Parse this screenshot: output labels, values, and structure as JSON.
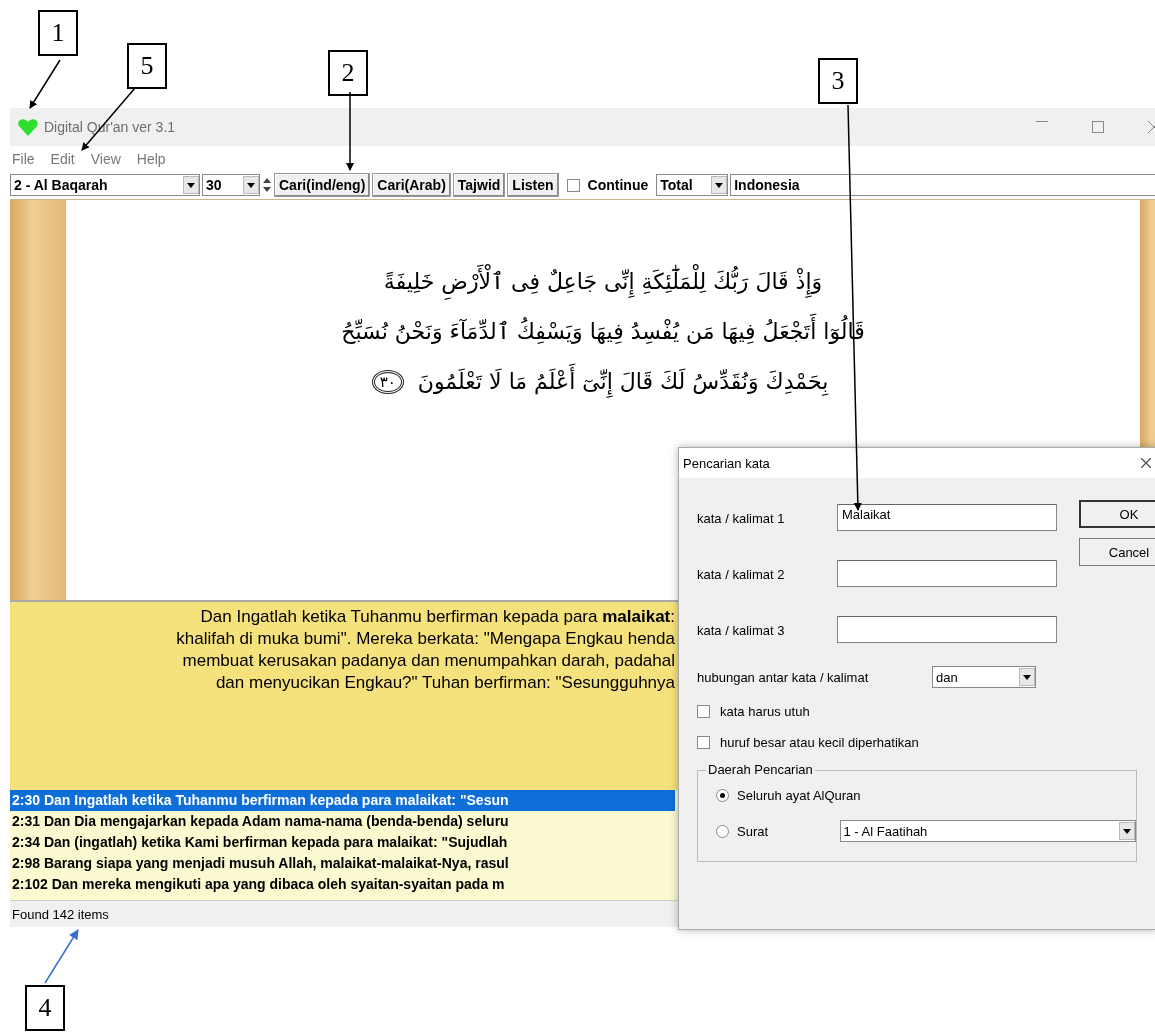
{
  "callouts": [
    {
      "label": "1"
    },
    {
      "label": "5"
    },
    {
      "label": "2"
    },
    {
      "label": "3"
    },
    {
      "label": "4"
    }
  ],
  "window": {
    "title": "Digital Qur'an ver 3.1"
  },
  "menu": [
    {
      "label": "File"
    },
    {
      "label": "Edit"
    },
    {
      "label": "View"
    },
    {
      "label": "Help"
    }
  ],
  "toolbar": {
    "surah": "2 - Al Baqarah",
    "ayah": "30",
    "buttons": [
      {
        "label": "Cari(ind/eng)"
      },
      {
        "label": "Cari(Arab)"
      },
      {
        "label": "Tajwid"
      },
      {
        "label": "Listen"
      }
    ],
    "continue": {
      "label": "Continue",
      "checked": false
    },
    "mode": "Total",
    "language": "Indonesia"
  },
  "verse": {
    "lines": [
      "وَإِذْ قَالَ رَبُّكَ لِلْمَلَٰٓئِكَةِ إِنِّى جَاعِلٌ فِى ٱلْأَرْضِ خَلِيفَةً",
      "قَالُوٓا أَتَجْعَلُ فِيهَا مَن يُفْسِدُ فِيهَا وَيَسْفِكُ ٱلدِّمَآءَ وَنَحْنُ نُسَبِّحُ",
      "بِحَمْدِكَ وَنُقَدِّسُ لَكَ قَالَ إِنِّىٓ أَعْلَمُ مَا لَا تَعْلَمُونَ"
    ],
    "number": "٣٠"
  },
  "translation": {
    "lines": [
      "Dan Ingatlah ketika Tuhanmu berfirman kepada para **malaikat**:",
      "khalifah di muka bumi\". Mereka berkata: \"Mengapa Engkau henda",
      "membuat kerusakan padanya dan menumpahkan darah, padahal",
      "dan menyucikan Engkau?\" Tuhan berfirman: \"Sesungguhnya"
    ]
  },
  "results": [
    {
      "text": "2:30 Dan Ingatlah ketika Tuhanmu berfirman kepada para malaikat: \"Sesun",
      "selected": true
    },
    {
      "text": "2:31 Dan Dia mengajarkan kepada Adam nama-nama (benda-benda) seluru",
      "selected": false
    },
    {
      "text": "2:34 Dan (ingatlah) ketika Kami berfirman kepada para malaikat: \"Sujudlah",
      "selected": false
    },
    {
      "text": "2:98 Barang siapa yang menjadi musuh Allah, malaikat-malaikat-Nya, rasul",
      "selected": false
    },
    {
      "text": "2:102 Dan mereka mengikuti apa yang dibaca oleh syaitan-syaitan pada m",
      "selected": false
    }
  ],
  "status_bar": "Found 142 items",
  "dialog": {
    "title": "Pencarian kata",
    "fields": [
      {
        "label": "kata / kalimat 1",
        "value": "Malaikat"
      },
      {
        "label": "kata / kalimat 2"
      },
      {
        "label": "kata / kalimat 3"
      }
    ],
    "buttons": [
      {
        "label": "OK"
      },
      {
        "label": "Cancel"
      }
    ],
    "relation": {
      "label": "hubungan antar kata / kalimat",
      "value": "dan"
    },
    "options": [
      {
        "label": "kata harus utuh",
        "checked": false
      },
      {
        "label": "huruf besar atau kecil diperhatikan",
        "checked": false
      }
    ],
    "area": {
      "title": "Daerah Pencarian",
      "choices": [
        {
          "label": "Seluruh ayat AlQuran",
          "selected": true
        },
        {
          "label": "Surat",
          "selected": false
        }
      ],
      "surah": "1 - Al Faatihah"
    }
  }
}
